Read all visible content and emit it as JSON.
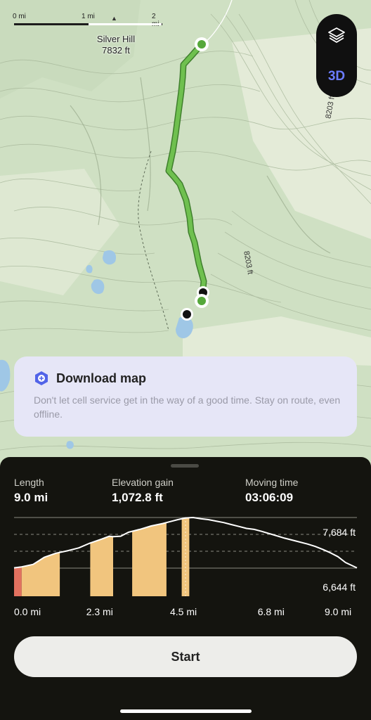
{
  "map": {
    "scale": {
      "left": "0 mi",
      "mid": "1 mi",
      "right": "2 mi"
    },
    "peak": {
      "name": "Silver Hill",
      "elevation": "7832 ft"
    },
    "contour_labels": [
      "8203 ft",
      "8203 ft"
    ],
    "controls": {
      "layers_icon": "layers-icon",
      "view_3d_label": "3D"
    }
  },
  "banner": {
    "icon": "download-shield-icon",
    "title": "Download map",
    "description": "Don't let cell service get in the way of a good time. Stay on route, even offline."
  },
  "stats": {
    "length": {
      "label": "Length",
      "value": "9.0 mi"
    },
    "elevation_gain": {
      "label": "Elevation gain",
      "value": "1,072.8 ft"
    },
    "moving_time": {
      "label": "Moving time",
      "value": "03:06:09"
    }
  },
  "chart_data": {
    "type": "area",
    "x_unit": "mi",
    "y_unit": "ft",
    "xlim": [
      0,
      9.0
    ],
    "ylim": [
      6644,
      7684
    ],
    "y_labels": [
      "7,684 ft",
      "6,644 ft"
    ],
    "x_ticks": [
      {
        "value": 0.0,
        "label": "0.0 mi"
      },
      {
        "value": 2.3,
        "label": "2.3 mi"
      },
      {
        "value": 4.5,
        "label": "4.5 mi"
      },
      {
        "value": 6.8,
        "label": "6.8 mi"
      },
      {
        "value": 9.0,
        "label": "9.0 mi"
      }
    ],
    "grid": "horizontal dashed",
    "cursor_x": 4.5,
    "x": [
      0.0,
      0.2,
      0.5,
      0.8,
      1.1,
      1.4,
      1.7,
      2.0,
      2.3,
      2.5,
      2.6,
      2.8,
      3.0,
      3.3,
      3.6,
      3.9,
      4.1,
      4.3,
      4.5,
      4.7,
      4.9,
      5.1,
      5.3,
      5.5,
      5.7,
      5.9,
      6.1,
      6.3,
      6.5,
      6.8,
      7.1,
      7.4,
      7.7,
      7.9,
      8.1,
      8.3,
      8.5,
      8.7,
      9.0
    ],
    "elevation": [
      6650,
      6670,
      6720,
      6870,
      6950,
      7000,
      7060,
      7160,
      7240,
      7300,
      7290,
      7300,
      7380,
      7440,
      7510,
      7560,
      7600,
      7640,
      7675,
      7684,
      7660,
      7640,
      7610,
      7580,
      7540,
      7500,
      7460,
      7440,
      7400,
      7330,
      7260,
      7200,
      7140,
      7090,
      7030,
      6960,
      6880,
      6760,
      6650
    ],
    "highlighted_segments": [
      {
        "from": 0.0,
        "to": 0.2,
        "color": "#e2715f"
      },
      {
        "from": 0.2,
        "to": 1.2,
        "color": "#f1c57e"
      },
      {
        "from": 2.0,
        "to": 2.6,
        "color": "#f1c57e"
      },
      {
        "from": 3.1,
        "to": 4.0,
        "color": "#f1c57e"
      },
      {
        "from": 4.4,
        "to": 4.6,
        "color": "#f1c57e"
      }
    ]
  },
  "start_button": {
    "label": "Start"
  },
  "colors": {
    "map_bg": "#cfe0c3",
    "route": "#6fc04f",
    "sheet_bg": "#14140f",
    "accent_3d": "#6b7cff"
  }
}
